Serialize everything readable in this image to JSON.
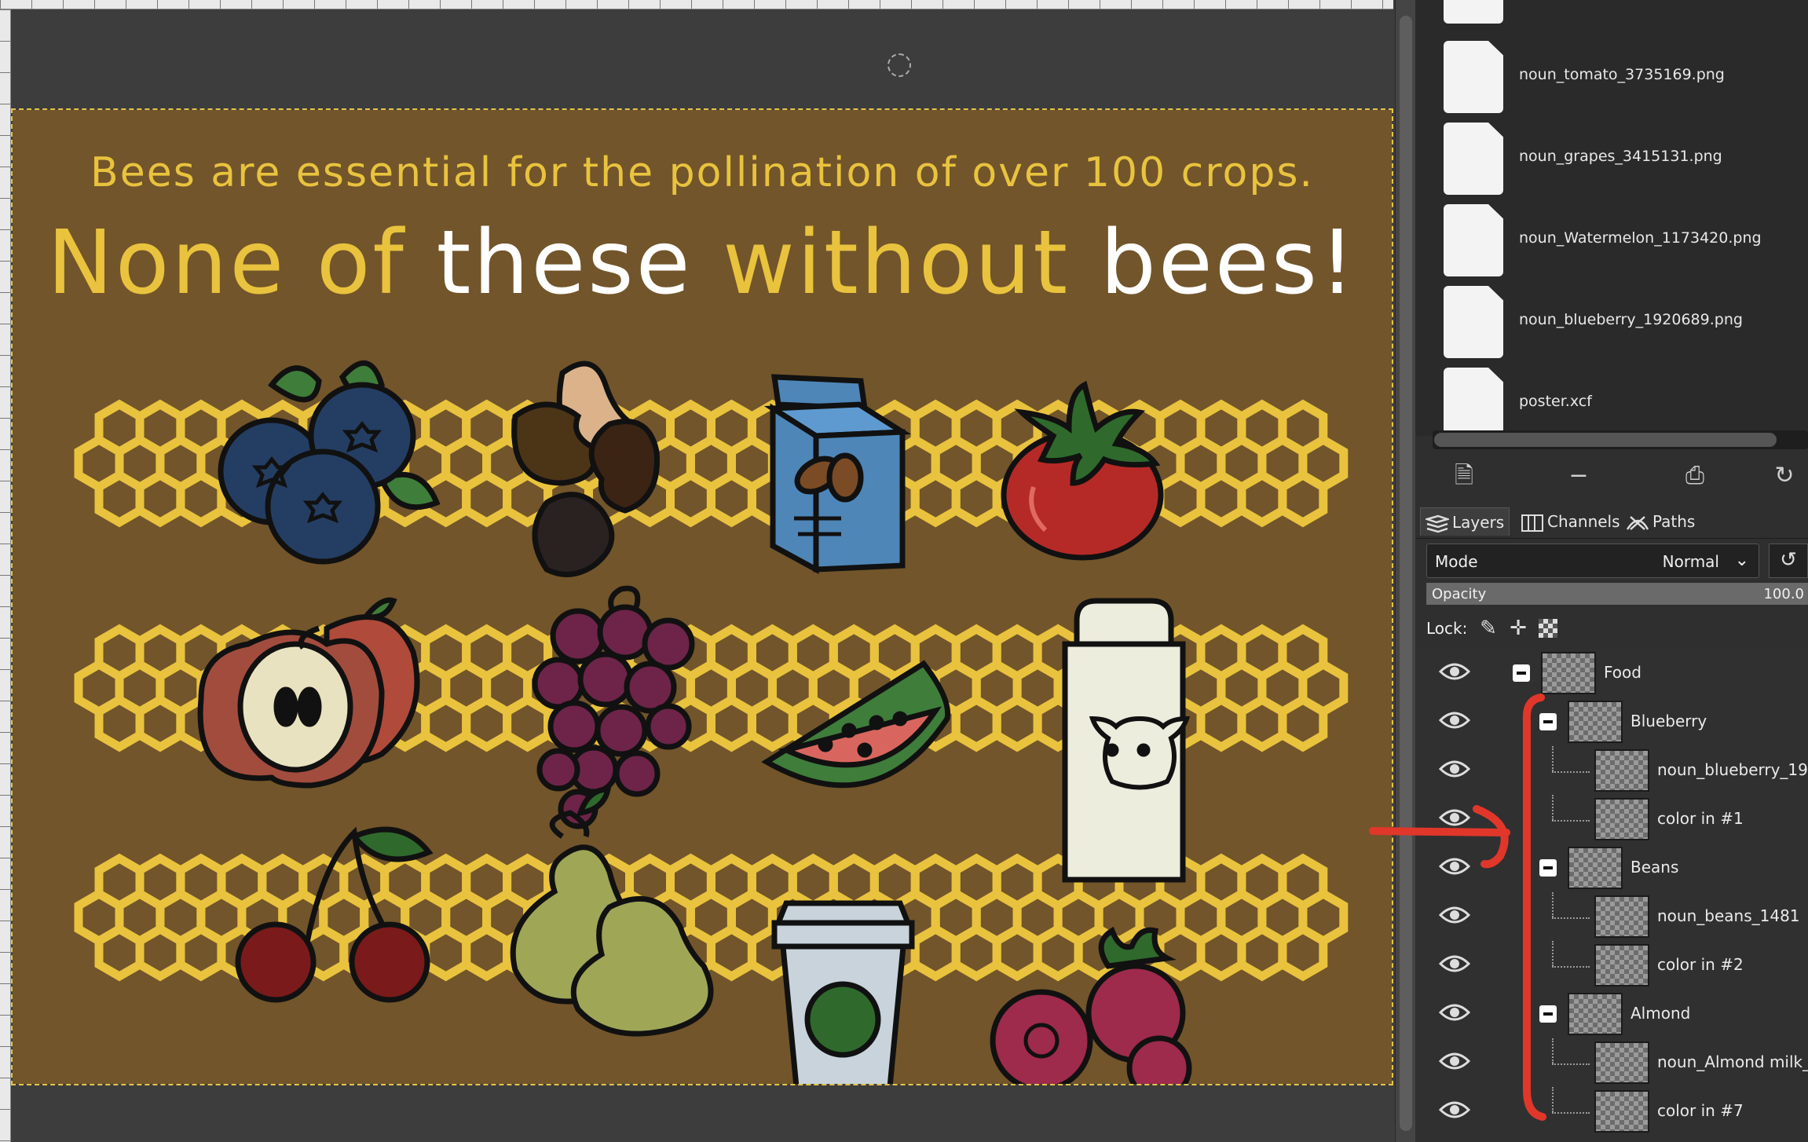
{
  "poster": {
    "subtitle": "Bees are essential for the pollination of over 100 crops.",
    "headline": {
      "part1": "None of ",
      "part2": "these",
      "part3": " without ",
      "part4": "bees!"
    },
    "colors": {
      "background": "#72552a",
      "accent": "#e9c33e",
      "white": "#ffffff",
      "honeycomb": "#e9c33e"
    },
    "foods": [
      "blueberry",
      "beans",
      "almond-milk",
      "tomato",
      "apple",
      "grapes",
      "watermelon",
      "cow-milk",
      "cherry",
      "pear",
      "coffee",
      "raspberry"
    ]
  },
  "files": [
    {
      "name": "noun_tomato_3735169.png"
    },
    {
      "name": "noun_grapes_3415131.png"
    },
    {
      "name": "noun_Watermelon_1173420.png"
    },
    {
      "name": "noun_blueberry_1920689.png"
    },
    {
      "name": "poster.xcf"
    }
  ],
  "file_toolbar": {
    "icons": [
      "open-image-icon",
      "remove-icon",
      "print-icon",
      "refresh-icon"
    ]
  },
  "tabs": [
    {
      "label": "Layers"
    },
    {
      "label": "Channels"
    },
    {
      "label": "Paths"
    }
  ],
  "mode": {
    "label": "Mode",
    "value": "Normal"
  },
  "opacity": {
    "label": "Opacity",
    "value": "100.0",
    "fraction": 1.0
  },
  "lock": {
    "label": "Lock:",
    "icons": [
      "lock-pixels-icon",
      "lock-position-icon",
      "lock-alpha-icon"
    ]
  },
  "layers": [
    {
      "name": "Food"
    },
    {
      "name": "Blueberry"
    },
    {
      "name": "noun_blueberry_19"
    },
    {
      "name": "color in #1"
    },
    {
      "name": "Beans"
    },
    {
      "name": "noun_beans_1481"
    },
    {
      "name": "color in #2"
    },
    {
      "name": "Almond"
    },
    {
      "name": "noun_Almond milk_"
    },
    {
      "name": "color in #7"
    }
  ],
  "annotation": {
    "color": "#e0372a"
  }
}
